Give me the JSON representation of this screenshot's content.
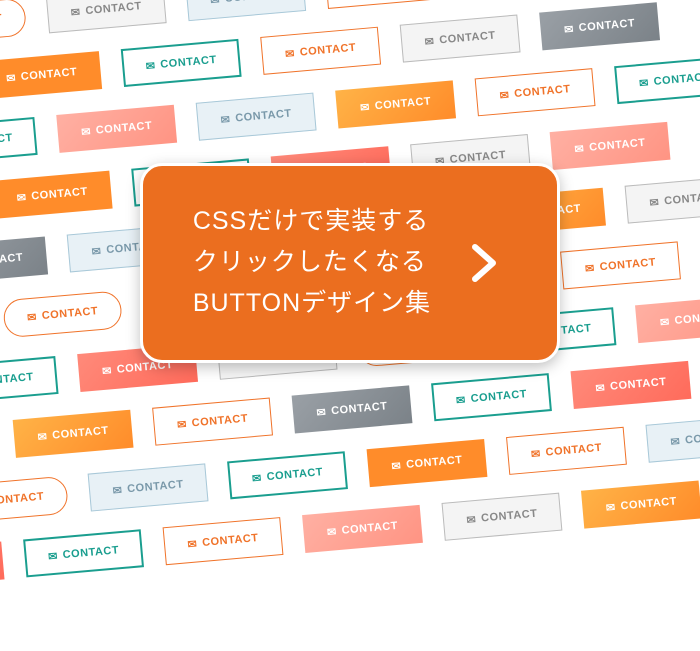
{
  "hero": {
    "line1": "CSSだけで実装する",
    "line2": "クリックしたくなる",
    "line3": "BUTTONデザイン集"
  },
  "button": {
    "label": "CONTACT",
    "icon": "mail-icon"
  },
  "bg_rows": [
    [
      "outline-teal",
      "solid-orangeflat corner-yellow",
      "outline-gray",
      "outline-teal",
      "solid-gray",
      "solid-orange"
    ],
    [
      "outline-orange rounded",
      "outline-gray",
      "outline-lightblue",
      "outline-orange",
      "outline-lightblue"
    ],
    [
      "solid-coral",
      "solid-orangeflat corner-yellow",
      "outline-teal",
      "outline-orange",
      "outline-gray",
      "solid-gray"
    ],
    [
      "outline-teal",
      "solid-pink",
      "outline-lightblue",
      "solid-orange",
      "outline-orange",
      "outline-teal"
    ],
    [
      "outline-orange",
      "solid-orangeflat",
      "outline-teal",
      "solid-coral",
      "outline-gray",
      "solid-pink"
    ],
    [
      "solid-gray",
      "outline-lightblue",
      "outline-orange",
      "outline-teal",
      "solid-orange",
      "outline-gray"
    ],
    [
      "solid-coral",
      "outline-orange rounded",
      "outline-teal",
      "solid-orangeflat corner-yellow",
      "outline-lightblue",
      "outline-orange"
    ],
    [
      "outline-teal",
      "solid-coral",
      "outline-gray",
      "outline-orange rounded",
      "outline-teal",
      "solid-pink"
    ],
    [
      "outline-lightblue",
      "solid-orange",
      "outline-orange",
      "solid-gray",
      "outline-teal",
      "solid-coral"
    ],
    [
      "outline-orange rounded",
      "outline-lightblue",
      "outline-teal",
      "solid-orangeflat",
      "outline-orange",
      "outline-lightblue"
    ],
    [
      "solid-coral",
      "outline-teal",
      "outline-orange",
      "solid-pink",
      "outline-gray",
      "solid-orange"
    ]
  ],
  "colors": {
    "hero_bg": "#eb6e1f",
    "teal": "#1a9e8f",
    "orange": "#f0732a"
  }
}
